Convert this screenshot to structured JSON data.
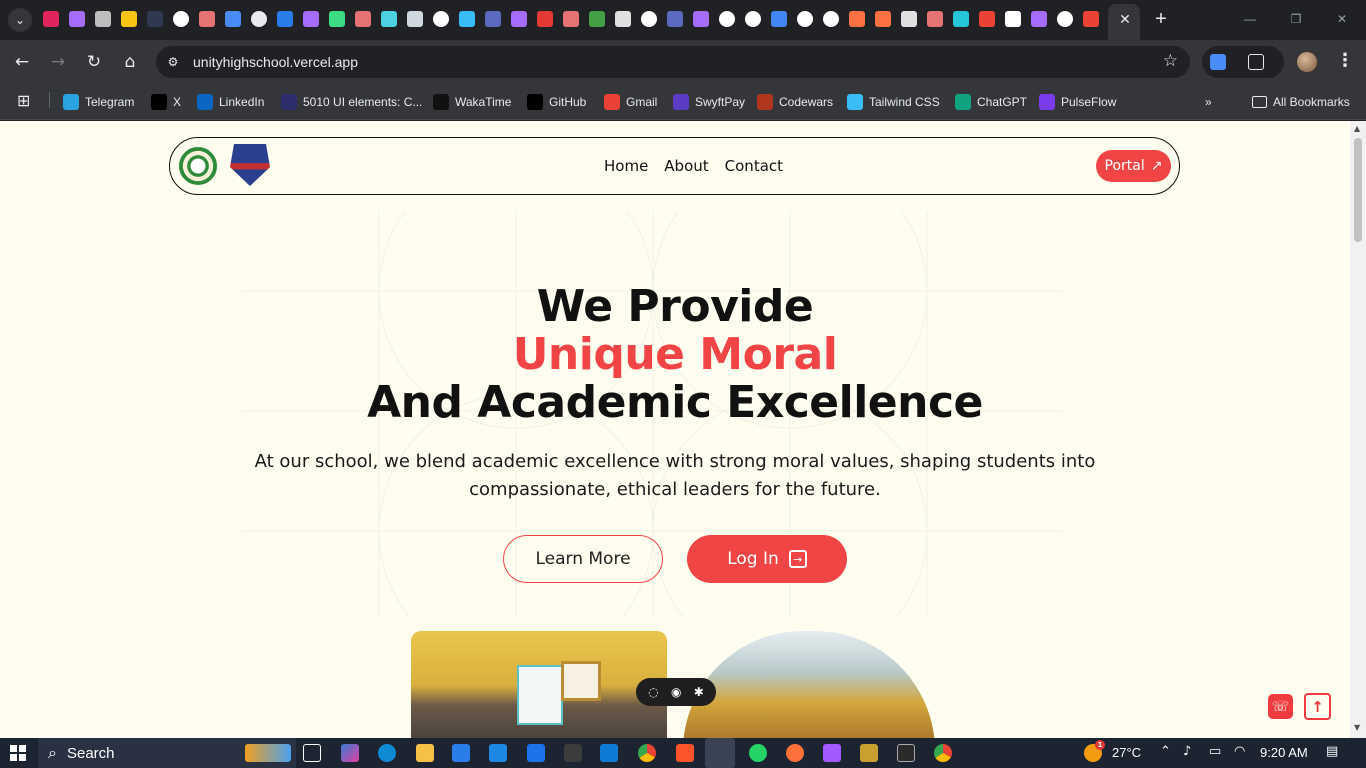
{
  "browser": {
    "tab_favicons": [
      "react-icon",
      "vite-icon",
      "seal-icon",
      "warning-icon",
      "dark-square-icon",
      "github-icon",
      "app-icon",
      "gemini-icon",
      "chatgpt-icon",
      "browser-icon",
      "vite-icon",
      "code-icon",
      "app-icon",
      "chart-icon",
      "globe-icon",
      "github-icon",
      "tailwind-icon",
      "stack-icon",
      "vite-icon",
      "n-icon",
      "app-icon",
      "map-icon",
      "doc-icon",
      "github-icon",
      "stack-icon",
      "vite-icon",
      "google-icon",
      "google-icon",
      "tools-icon",
      "google-icon",
      "google-icon",
      "helmet-icon",
      "helmet-icon",
      "doc-icon",
      "app-icon",
      "circle-icon",
      "gmail-icon",
      "triangle-icon",
      "vite-icon",
      "google-icon",
      "gmail-icon"
    ],
    "url": "unityhighschool.vercel.app",
    "bookmarks": [
      {
        "label": "Telegram",
        "color": "#2aa3e0"
      },
      {
        "label": "X",
        "color": "#000000"
      },
      {
        "label": "LinkedIn",
        "color": "#0a66c2"
      },
      {
        "label": "5010 UI elements: C...",
        "color": "#2d2d6b"
      },
      {
        "label": "WakaTime",
        "color": "#111111"
      },
      {
        "label": "GitHub",
        "color": "#000000"
      },
      {
        "label": "Gmail",
        "color": "#ea4335"
      },
      {
        "label": "SwyftPay",
        "color": "#5b3cc4"
      },
      {
        "label": "Codewars",
        "color": "#b1361e"
      },
      {
        "label": "Tailwind CSS",
        "color": "#38bdf8"
      },
      {
        "label": "ChatGPT",
        "color": "#10a37f"
      },
      {
        "label": "PulseFlow",
        "color": "#7c3aed"
      }
    ],
    "all_bookmarks": "All Bookmarks"
  },
  "page": {
    "nav": {
      "home": "Home",
      "about": "About",
      "contact": "Contact",
      "portal": "Portal"
    },
    "hero": {
      "line1": "We Provide",
      "line2": "Unique Moral",
      "line3": "And Academic Excellence",
      "subtitle": "At our school, we blend academic excellence with strong moral values, shaping students into compassionate, ethical leaders for the future.",
      "learn_more": "Learn More",
      "log_in": "Log In"
    },
    "accent_color": "#f04445",
    "background_color": "#fffdf0"
  },
  "taskbar": {
    "search": "Search",
    "temperature": "27°C",
    "time": "9:20 AM",
    "weather_badge": "1"
  }
}
